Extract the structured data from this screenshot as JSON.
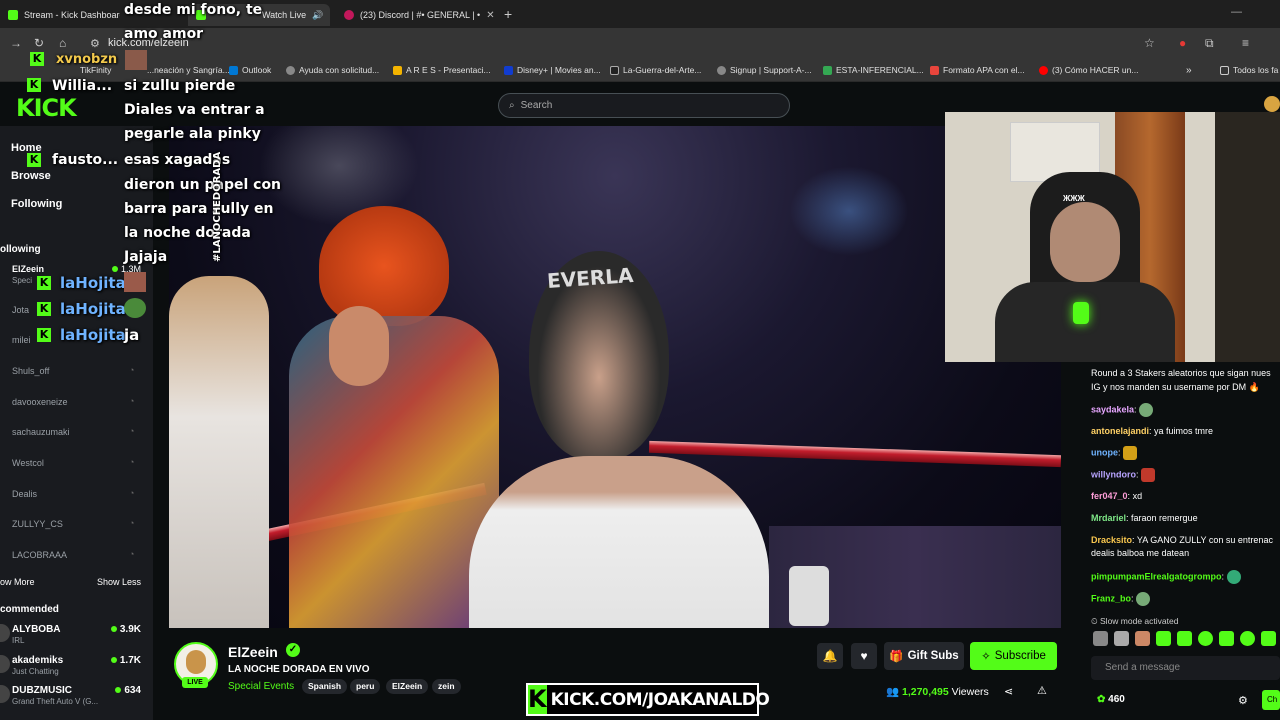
{
  "browser": {
    "tabs": [
      {
        "title": "Stream - Kick Dashboard",
        "color": "#53fc18"
      },
      {
        "title": "Watch Live",
        "color": "#53fc18"
      },
      {
        "title": "(23) Discord | #• GENERAL | •",
        "color": "#c2185b"
      }
    ],
    "url": "kick.com/elzeein",
    "bookmarks": [
      "TikFinity",
      "...neación y Sangría...",
      "Outlook",
      "Ayuda con solicitud...",
      "A R E S - Presentaci...",
      "Disney+ | Movies an...",
      "La-Guerra-del-Arte...",
      "Signup | Support-A-...",
      "ESTA-INFERENCIAL...",
      "Formato APA con el...",
      "(3) Cómo HACER un...",
      "Todos los fa"
    ]
  },
  "kick": {
    "logo": "KICK",
    "search_placeholder": "Search"
  },
  "sidebar": {
    "nav": [
      "Home",
      "Browse",
      "Following"
    ],
    "following_header": "ollowing",
    "following": [
      {
        "name": "ElZeein",
        "sub": "Speci",
        "count": "1.3M",
        "live": true
      },
      {
        "name": "Jota",
        "live": false
      },
      {
        "name": "milei",
        "live": false
      },
      {
        "name": "Shuls_off",
        "live": false
      },
      {
        "name": "davooxeneize",
        "live": false
      },
      {
        "name": "sachauzumaki",
        "live": false
      },
      {
        "name": "Westcol",
        "live": false
      },
      {
        "name": "Dealis",
        "live": false
      },
      {
        "name": "ZULLYY_CS",
        "live": false
      },
      {
        "name": "LACOBRAAA",
        "live": false
      }
    ],
    "show_more": "ow More",
    "show_less": "Show Less",
    "recommended_header": "commended",
    "recommended": [
      {
        "name": "ALYBOBA",
        "sub": "IRL",
        "count": "3.9K"
      },
      {
        "name": "akademiks",
        "sub": "Just Chatting",
        "count": "1.7K"
      },
      {
        "name": "DUBZMUSIC",
        "sub": "Grand Theft Auto V (G...",
        "count": "634"
      }
    ]
  },
  "overlay": {
    "message_lines": [
      "desde mi fono, te",
      "amo amor"
    ],
    "user1": "xvnobzn",
    "user2": "Willia...",
    "user3": "fausto...",
    "big_text": [
      "si zullu pierde",
      "Diales va entrar a",
      "pegarle ala pinky",
      "esas xagadas",
      "dieron un papel con",
      "barra para zully en",
      "la noche dorada",
      "Jajaja"
    ],
    "lahojita": [
      {
        "name": "laHojita",
        "msg": ""
      },
      {
        "name": "laHojita",
        "msg": ""
      },
      {
        "name": "laHojita",
        "msg": "ja"
      }
    ],
    "banner": "KICK.COM/JOAKANALDO",
    "hashtag": "#LANOCHEDORADA"
  },
  "channel": {
    "name": "ElZeein",
    "live_badge": "LIVE",
    "title": "LA NOCHE DORADA EN VIVO",
    "category": "Special Events",
    "tags": [
      "Spanish",
      "peru",
      "ElZeein",
      "zein"
    ],
    "gift_label": "Gift Subs",
    "subscribe_label": "Subscribe",
    "viewers_count": "1,270,495",
    "viewers_label": "Viewers"
  },
  "chat": {
    "pinned_lines": [
      "Round a 3 Stakers aleatorios que sigan nues",
      "IG y nos manden su username por DM 🔥"
    ],
    "messages": [
      {
        "user": "saydakela",
        "text": "",
        "color": "#e7a6ff",
        "emote": "#7a7"
      },
      {
        "user": "antonelajandi",
        "text": "ya fuimos tmre",
        "color": "#ffd166",
        "emote": ""
      },
      {
        "user": "unope",
        "text": "",
        "color": "#6fb3ff",
        "emote": "#d4a017"
      },
      {
        "user": "willyndoro",
        "text": "",
        "color": "#b8a4ff",
        "emote": "#c0392b"
      },
      {
        "user": "fer047_0",
        "text": "xd",
        "color": "#ff9ed8",
        "emote": ""
      },
      {
        "user": "Mrdariel",
        "text": "faraon remergue",
        "color": "#7ee787",
        "emote": ""
      },
      {
        "user": "Dracksito",
        "text": "YA GANO ZULLY con su entrenac",
        "color": "#f9c74f",
        "emote": ""
      },
      {
        "user": "",
        "text": "dealis balboa me datean",
        "color": "#ffffff",
        "emote": ""
      },
      {
        "user": "pimpumpamElrealgatogrompo",
        "text": "",
        "color": "#53fc18",
        "emote": "#3a7"
      },
      {
        "user": "Franz_bo",
        "text": "",
        "color": "#53fc18",
        "emote": "#7a7"
      }
    ],
    "slow_mode": "Slow mode activated",
    "input_placeholder": "Send a message",
    "points": "460",
    "send_label": "Ch"
  }
}
